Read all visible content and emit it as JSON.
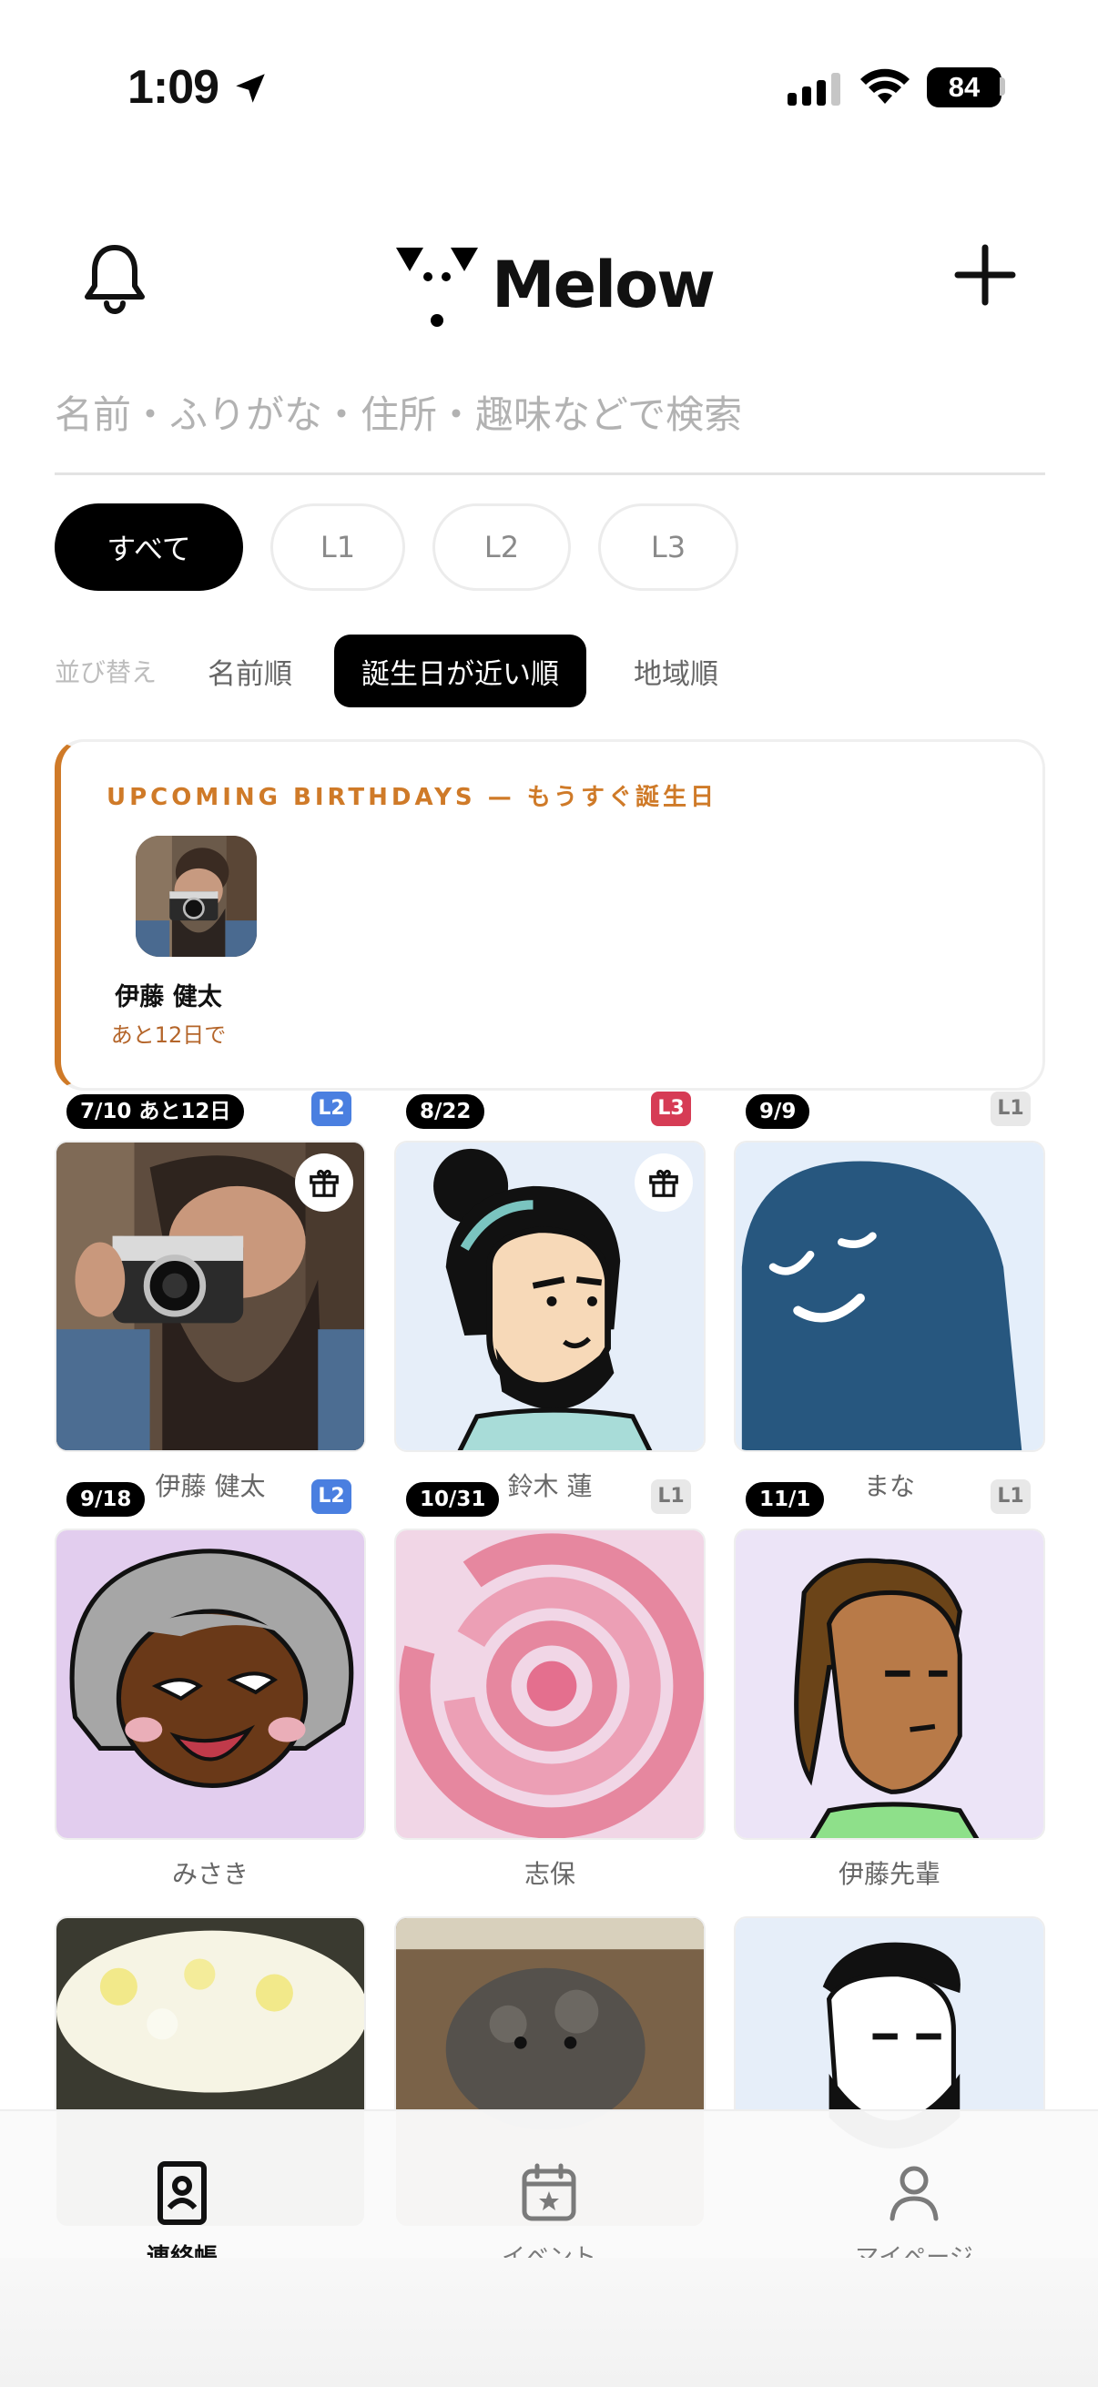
{
  "status_bar": {
    "time": "1:09",
    "battery": "84"
  },
  "header": {
    "app_name": "Melow"
  },
  "search": {
    "placeholder": "名前・ふりがな・住所・趣味などで検索"
  },
  "filters": {
    "all": "すべて",
    "l1": "L1",
    "l2": "L2",
    "l3": "L3",
    "active": "all"
  },
  "sort": {
    "label": "並び替え",
    "by_name": "名前順",
    "by_birthday": "誕生日が近い順",
    "by_region": "地域順",
    "active": "by_birthday"
  },
  "upcoming": {
    "title": "UPCOMING BIRTHDAYS — もうすぐ誕生日",
    "accent": "#cf7a28",
    "people": [
      {
        "name": "伊藤 健太",
        "days": "あと12日で"
      }
    ]
  },
  "contacts": [
    {
      "name": "伊藤 健太",
      "date": "7/10 あと12日",
      "level": "L2",
      "gift": true
    },
    {
      "name": "鈴木 蓮",
      "date": "8/22",
      "level": "L3",
      "gift": true
    },
    {
      "name": "まな",
      "date": "9/9",
      "level": "L1",
      "gift": false
    },
    {
      "name": "みさき",
      "date": "9/18",
      "level": "L2",
      "gift": false
    },
    {
      "name": "志保",
      "date": "10/31",
      "level": "L1",
      "gift": false
    },
    {
      "name": "伊藤先輩",
      "date": "11/1",
      "level": "L1",
      "gift": false
    },
    {
      "name": "",
      "date": "",
      "level": "",
      "gift": false
    },
    {
      "name": "",
      "date": "",
      "level": "",
      "gift": false
    },
    {
      "name": "",
      "date": "",
      "level": "",
      "gift": false
    }
  ],
  "tabbar": {
    "contacts": "連絡帳",
    "events": "イベント",
    "mypage": "マイページ",
    "active": "contacts"
  },
  "colors": {
    "level_l1": "#e8e8e8",
    "level_l2": "#4a7fe0",
    "level_l3": "#d63c55"
  }
}
